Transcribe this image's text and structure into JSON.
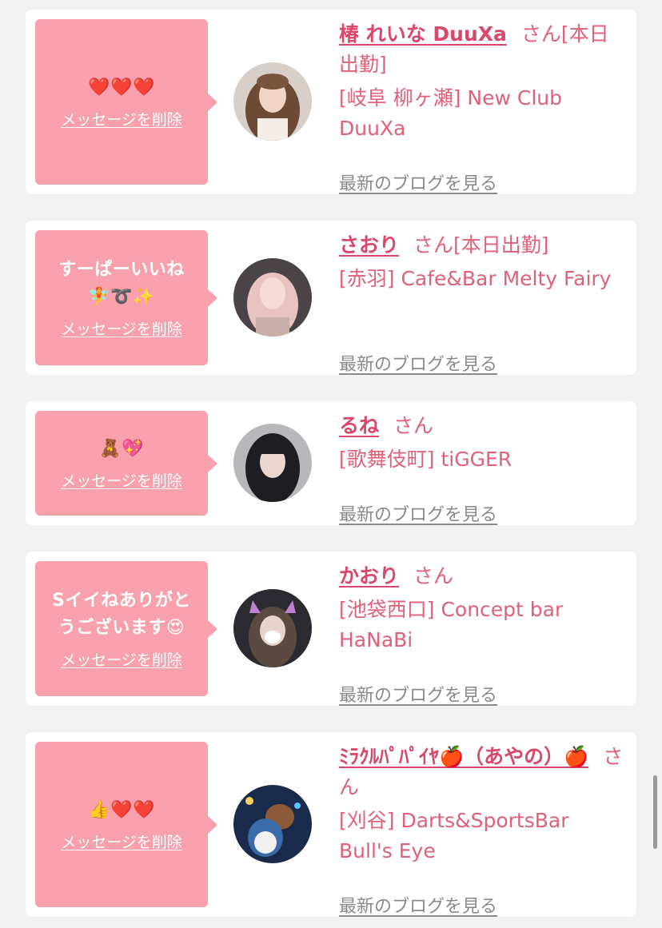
{
  "cards": [
    {
      "message": "❤️❤️❤️",
      "delete_label": "メッセージを削除",
      "name": "椿 れいな DuuXa",
      "suffix": "さん[本日出勤]",
      "shop": "[岐阜 柳ヶ瀬] New Club DuuXa",
      "blog_label": "最新のブログを見る",
      "avatar_icon": "profile-photo-long-brown-hair"
    },
    {
      "message": "すーぱーいいね\n🧚➰✨",
      "delete_label": "メッセージを削除",
      "name": "さおり",
      "suffix": "さん[本日出勤]",
      "shop": "[赤羽] Cafe&Bar Melty Fairy",
      "blog_label": "最新のブログを見る",
      "avatar_icon": "profile-photo-light-pink-hair"
    },
    {
      "message": "🧸💖",
      "delete_label": "メッセージを削除",
      "name": "るね",
      "suffix": "さん",
      "shop": "[歌舞伎町] tiGGER",
      "blog_label": "最新のブログを見る",
      "avatar_icon": "profile-photo-black-hair"
    },
    {
      "message": "Sイイねありがと\nうございます😍",
      "delete_label": "メッセージを削除",
      "name": "かおり",
      "suffix": "さん",
      "shop": "[池袋西口] Concept bar HaNaBi",
      "blog_label": "最新のブログを見る",
      "avatar_icon": "profile-photo-cat-filter"
    },
    {
      "message": "👍❤️❤️",
      "delete_label": "メッセージを削除",
      "name": "ﾐﾗｸﾙﾊﾟﾊﾟｲﾔ🍎（あやの）🍎",
      "suffix": "さん",
      "shop": "[刈谷] Darts&SportsBar Bull's Eye",
      "blog_label": "最新のブログを見る",
      "avatar_icon": "profile-photo-mascot-costume"
    }
  ],
  "colors": {
    "bubble": "#f8a0ac",
    "name": "#d9486a",
    "shop": "#e0607a",
    "link_gray": "#8a8a8a",
    "background": "#f2f2f2"
  }
}
